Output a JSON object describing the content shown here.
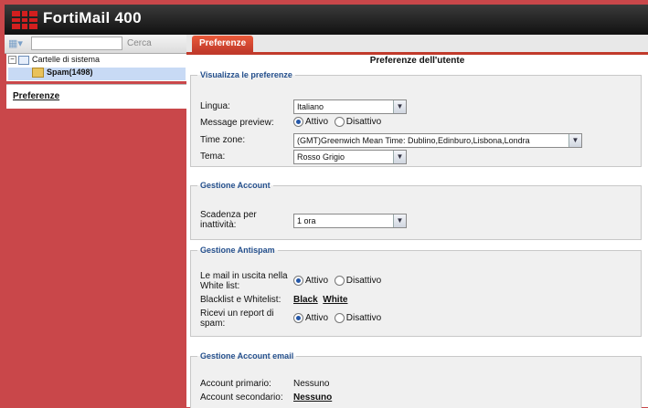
{
  "header": {
    "title": "FortiMail 400"
  },
  "sidebar": {
    "search_label": "Cerca",
    "tree": [
      {
        "label": "Cartelle di sistema"
      },
      {
        "label": "Spam(1498)"
      }
    ],
    "preferences_link": "Preferenze"
  },
  "tabs": [
    {
      "label": "Preferenze"
    }
  ],
  "page_title": "Preferenze dell'utente",
  "sections": {
    "display": {
      "legend": "Visualizza le preferenze",
      "lingua_label": "Lingua:",
      "lingua_value": "Italiano",
      "preview_label": "Message preview:",
      "attivo": "Attivo",
      "disattivo": "Disattivo",
      "timezone_label": "Time zone:",
      "timezone_value": "(GMT)Greenwich Mean Time: Dublino,Edinburo,Lisbona,Londra",
      "tema_label": "Tema:",
      "tema_value": "Rosso Grigio"
    },
    "account": {
      "legend": "Gestione Account",
      "timeout_label": "Scadenza per inattività:",
      "timeout_value": "1 ora"
    },
    "antispam": {
      "legend": "Gestione Antispam",
      "outgoing_label": "Le mail in uscita nella White list:",
      "attivo": "Attivo",
      "disattivo": "Disattivo",
      "lists_label": "Blacklist e Whitelist:",
      "black": "Black",
      "white": "White",
      "report_label": "Ricevi un report di spam:"
    },
    "email_accounts": {
      "legend": "Gestione Account email",
      "primary_label": "Account primario:",
      "primary_value": "Nessuno",
      "secondary_label": "Account secondario:",
      "secondary_value": "Nessuno"
    }
  },
  "colors": {
    "accent": "#c13a2b",
    "legend": "#244f8c",
    "frame": "#c9474a"
  }
}
